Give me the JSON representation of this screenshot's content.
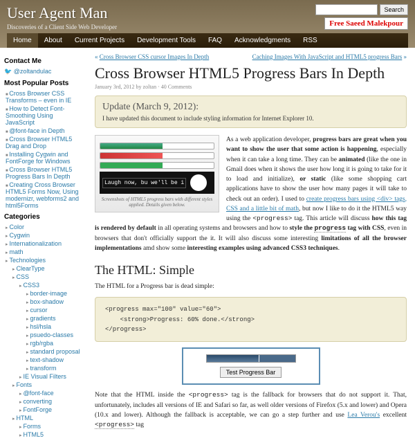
{
  "site": {
    "title": "User Agent Man",
    "tagline": "Discoveries of a Client Side Web Developer"
  },
  "search": {
    "placeholder": "",
    "button": "Search"
  },
  "promo": "Free Saeed Malekpour",
  "nav": [
    "Home",
    "About",
    "Current Projects",
    "Development Tools",
    "FAQ",
    "Acknowledgments",
    "RSS"
  ],
  "sidebar": {
    "contact_heading": "Contact Me",
    "twitter": "@zoltandulac",
    "popular_heading": "Most Popular Posts",
    "popular": [
      "Cross Browser CSS Transforms – even in IE",
      "How to Detect Font-Smoothing Using JavaScript",
      "@font-face in Depth",
      "Cross Browser HTML5 Drag and Drop",
      "Installing Cygwin and FontForge for Windows",
      "Cross Browser HTML5 Progress Bars In Depth",
      "Creating Cross Browser HTML5 Forms Now, Using modernizr, webforms2 and html5Forms"
    ],
    "categories_heading": "Categories",
    "categories_top": [
      "Color",
      "Cygwin",
      "Internationalization",
      "math",
      "Technologies"
    ],
    "tech_children": [
      "ClearType",
      "CSS"
    ],
    "css_children": [
      "CSS3"
    ],
    "css3_children": [
      "border-image",
      "box-shadow",
      "cursor",
      "gradients",
      "hsl/hsla",
      "psuedo-classes",
      "rgb/rgba",
      "standard proposal",
      "text-shadow",
      "transform"
    ],
    "after_css3": [
      "IE Visual Filters"
    ],
    "fonts": "Fonts",
    "fonts_children": [
      "@font-face",
      "converting",
      "FontForge"
    ],
    "html": "HTML",
    "html_children": [
      "Forms",
      "HTML5"
    ]
  },
  "article": {
    "prev": "Cross Browser CSS cursor Images In Depth",
    "next": "Caching Images With JavaScript and HTML5 progress Bars",
    "title": "Cross Browser HTML5 Progress Bars In Depth",
    "meta": "January 3rd, 2012 by zoltan · 40 Comments",
    "update_heading": "Update (March 9, 2012):",
    "update_body": "I have updated this document to include styling information for Internet Explorer 10.",
    "screenshot_dark": "Laugh now, bu\nwe'll be i",
    "screenshot_caption": "Screenshots of HTML5 progress bars with different styles applied. Details given below.",
    "intro": "As a web application developer, <strong>progress bars are great when you want to show the user that some action is happening</strong>, especially when it can take a long time. They can be <strong>animated</strong> (like the one in Gmail does when it shows the user how long it is going to take for it to load and initialize), <strong>or static</strong> (like some shopping cart applications have to show the user how many pages it will take to check out an order). I used to <a>create progress bars using &lt;div&gt; tags, CSS and a little bit of math</a>, but now I like to do it the HTML5 way using the <span class=\"mono\">&lt;progress&gt;</span> tag. This article will discuss <strong>how this tag is rendered by default</strong> in all operating systems and browsers and how to <strong>style the <span class=\"mono dotted\">progress</span> tag with CSS</strong>, even in browsers that don't officially support the it. It will also discuss some interesting <strong>limitations of all the browser implementations</strong> amd show some <strong>interesting examples using advanced CSS3 techniques</strong>.",
    "section_heading": "The HTML: Simple",
    "section_intro": "The HTML for a Progress bar is dead simple:",
    "code": "<progress max=\"100\" value=\"60\">\n    <strong>Progress: 60% done.</strong>\n</progress>",
    "demo_button": "Test Progress Bar",
    "note": "Note that the HTML inside the <span class=\"mono\">&lt;progress&gt;</span> tag is the fallback for browsers that do not support it. That, unfortunately, includes all versions of IE and Safari so far, as well older versions of Firefox (5.x and lower) and Opera (10.x and lower). Although the fallback is acceptable, we can go a step further and use <a>Lea Verou's</a> excellent <span class=\"mono dotted\">&lt;progress&gt;</span> tag"
  }
}
